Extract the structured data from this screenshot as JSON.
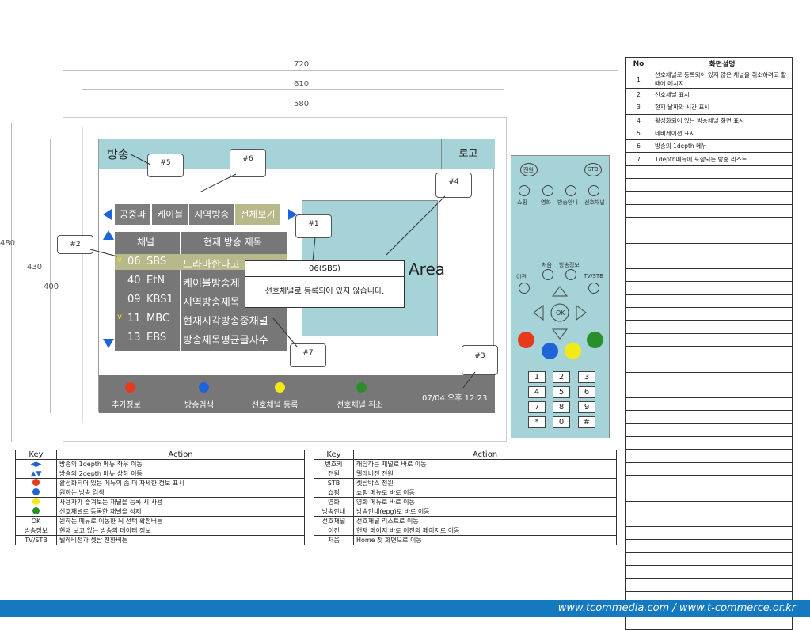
{
  "dimensions": {
    "w720": "720",
    "w610": "610",
    "w580": "580",
    "h480": "480",
    "h430": "430",
    "h400": "400"
  },
  "screen": {
    "title": "방송",
    "logo": "로고",
    "tabs": [
      "공중파",
      "케이블",
      "지역방송",
      "전체보기"
    ],
    "list_header": {
      "channel": "채널",
      "program": "현재 방송 제목"
    },
    "rows": [
      {
        "mark": "v",
        "num": "06",
        "name": "SBS",
        "program": "드라마한다고"
      },
      {
        "mark": "",
        "num": "40",
        "name": "EtN",
        "program": "케이블방송제"
      },
      {
        "mark": "",
        "num": "09",
        "name": "KBS1",
        "program": "지역방송제목"
      },
      {
        "mark": "v",
        "num": "11",
        "name": "MBC",
        "program": "현재시각방송중채널"
      },
      {
        "mark": "",
        "num": "13",
        "name": "EBS",
        "program": "방송제목평균글자수"
      }
    ],
    "area_label": "Area",
    "popup": {
      "title": "06(SBS)",
      "message": "선호채널로 등록되어 있지 않습니다."
    },
    "bottom": [
      {
        "label": "추가정보",
        "color": "#e53b1c"
      },
      {
        "label": "방송검색",
        "color": "#1e63d8"
      },
      {
        "label": "선호채널 등록",
        "color": "#f2ea17"
      },
      {
        "label": "선호채널 취소",
        "color": "#2a8f2a"
      }
    ],
    "datetime": "07/04 오후 12:23"
  },
  "callouts": [
    "#1",
    "#2",
    "#3",
    "#4",
    "#5",
    "#6",
    "#7"
  ],
  "remote": {
    "power": "전원",
    "stb": "STB",
    "row_labels": [
      "쇼핑",
      "영화",
      "방송안내",
      "선호채널"
    ],
    "first": "처음",
    "info": "방송정보",
    "prev": "이전",
    "tvstb": "TV/STB",
    "ok": "OK",
    "keys": [
      "1",
      "2",
      "3",
      "4",
      "5",
      "6",
      "7",
      "8",
      "9",
      "*",
      "0",
      "#"
    ]
  },
  "key_table_left": {
    "headers": [
      "Key",
      "Action"
    ],
    "rows": [
      {
        "key": "◀ ▶",
        "action": "방송의 1depth 메뉴 좌우 이동"
      },
      {
        "key": "▲▼",
        "action": "방송의 2depth 메뉴 상하 이동"
      },
      {
        "key": "red",
        "action": "활성화되어 있는 메뉴의 좀 더 자세한 정보 표시"
      },
      {
        "key": "blue",
        "action": "원하는 방송 검색"
      },
      {
        "key": "yellow",
        "action": "사용자가 즐겨보는 채널을 등록 시 사용"
      },
      {
        "key": "green",
        "action": "선호채널로 등록한 채널을 삭제"
      },
      {
        "key": "OK",
        "action": "원하는 메뉴로 이동한 뒤 선택 확정버튼"
      },
      {
        "key": "방송정보",
        "action": "현재 보고 있는 방송의 데이터 정보"
      },
      {
        "key": "TV/STB",
        "action": "텔레비전과 셋탑 전환버튼"
      }
    ]
  },
  "key_table_right": {
    "headers": [
      "Key",
      "Action"
    ],
    "rows": [
      {
        "key": "번호키",
        "action": "해당하는 채널로 바로 이동"
      },
      {
        "key": "전원",
        "action": "텔레비전 전원"
      },
      {
        "key": "STB",
        "action": "셋탑박스 전원"
      },
      {
        "key": "쇼핑",
        "action": "쇼핑 메뉴로 바로 이동"
      },
      {
        "key": "영화",
        "action": "영화 메뉴로 바로 이동"
      },
      {
        "key": "방송안내",
        "action": "방송안내(epg)로 바로 이동"
      },
      {
        "key": "선호채널",
        "action": "선호채널 리스트로 이동"
      },
      {
        "key": "이전",
        "action": "현재 페이지 바로 이전의 페이지로 이동"
      },
      {
        "key": "처음",
        "action": "Home 첫 화면으로 이동"
      }
    ]
  },
  "desc_table": {
    "headers": [
      "No",
      "화면설명"
    ],
    "rows": [
      {
        "no": "1",
        "desc": "선호채널로 등록되어 있지 않은 채널을 취소하려고 할 때에 메시지"
      },
      {
        "no": "2",
        "desc": "선호채널 표시"
      },
      {
        "no": "3",
        "desc": "현재 날짜와 시간 표시"
      },
      {
        "no": "4",
        "desc": "활성화되어 있는 방송채널 화면 표시"
      },
      {
        "no": "5",
        "desc": "네비게이션 표시"
      },
      {
        "no": "6",
        "desc": "방송의 1depth 메뉴"
      },
      {
        "no": "7",
        "desc": "1depth메뉴에 포함되는 방송 리스트"
      }
    ],
    "empty_rows": 36
  },
  "footer": "www.tcommedia.com / www.t-commerce.or.kr"
}
